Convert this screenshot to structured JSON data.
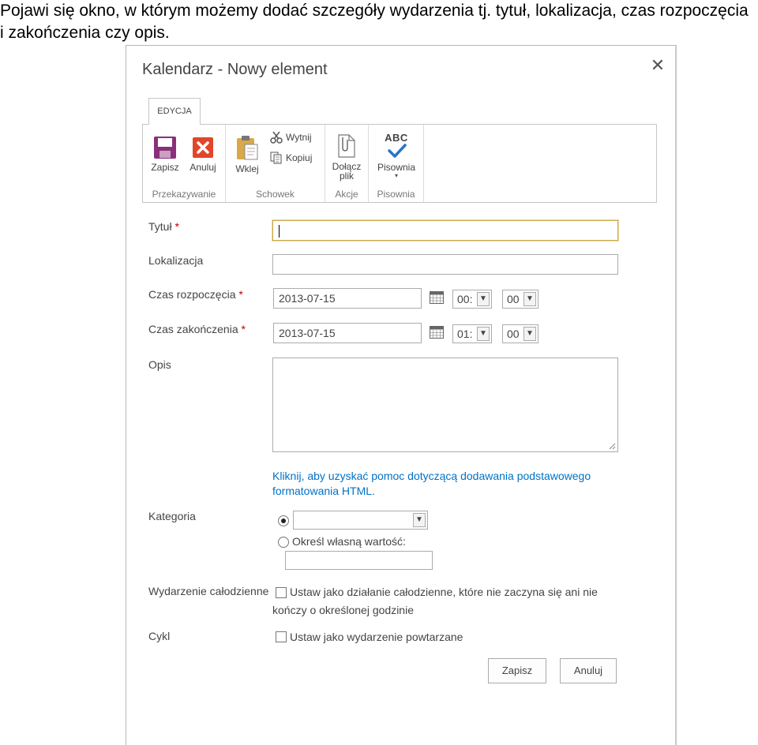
{
  "caption": {
    "line1": "Pojawi się okno, w którym możemy dodać szczegóły wydarzenia tj. tytuł, lokalizacja, czas rozpoczęcia",
    "line2": "i zakończenia czy opis."
  },
  "dialog": {
    "title": "Kalendarz - Nowy element",
    "close_icon": "close-icon"
  },
  "ribbon": {
    "tab": "EDYCJA",
    "groups": [
      {
        "label": "Przekazywanie",
        "buttons": [
          {
            "label": "Zapisz",
            "icon": "save-icon"
          },
          {
            "label": "Anuluj",
            "icon": "cancel-icon"
          }
        ]
      },
      {
        "label": "Schowek",
        "buttons": [
          {
            "label": "Wklej",
            "icon": "paste-icon"
          },
          {
            "label": "Wytnij",
            "icon": "cut-icon"
          },
          {
            "label": "Kopiuj",
            "icon": "copy-icon"
          }
        ]
      },
      {
        "label": "Akcje",
        "buttons": [
          {
            "label_line1": "Dołącz",
            "label_line2": "plik",
            "icon": "attach-icon"
          }
        ]
      },
      {
        "label": "Pisownia",
        "buttons": [
          {
            "label": "Pisownia",
            "icon": "spelling-icon",
            "badge": "ABC"
          }
        ]
      }
    ]
  },
  "form": {
    "title": {
      "label": "Tytuł",
      "required": "*",
      "value": ""
    },
    "location": {
      "label": "Lokalizacja",
      "value": ""
    },
    "start": {
      "label": "Czas rozpoczęcia",
      "required": "*",
      "date": "2013-07-15",
      "hour": "00:",
      "minute": "00"
    },
    "end": {
      "label": "Czas zakończenia",
      "required": "*",
      "date": "2013-07-15",
      "hour": "01:",
      "minute": "00"
    },
    "description": {
      "label": "Opis",
      "value": ""
    },
    "help_link": "Kliknij, aby uzyskać pomoc dotyczącą dodawania podstawowego formatowania HTML.",
    "category": {
      "label": "Kategoria",
      "selected": "",
      "custom_option": "Określ własną wartość:",
      "custom_value": ""
    },
    "all_day": {
      "label": "Wydarzenie całodzienne",
      "text_line1": "Ustaw jako działanie całodzienne, które nie zaczyna się ani nie",
      "text_line2": "kończy o określonej godzinie",
      "checked": false
    },
    "recurrence": {
      "label": "Cykl",
      "text": "Ustaw jako wydarzenie powtarzane",
      "checked": false
    }
  },
  "footer": {
    "save": "Zapisz",
    "cancel": "Anuluj"
  },
  "colors": {
    "link": "#0072c6",
    "required": "#bf0000",
    "save_icon": "#8a2f7a",
    "cancel_icon": "#e2462a",
    "spell_check": "#2a74c8"
  }
}
